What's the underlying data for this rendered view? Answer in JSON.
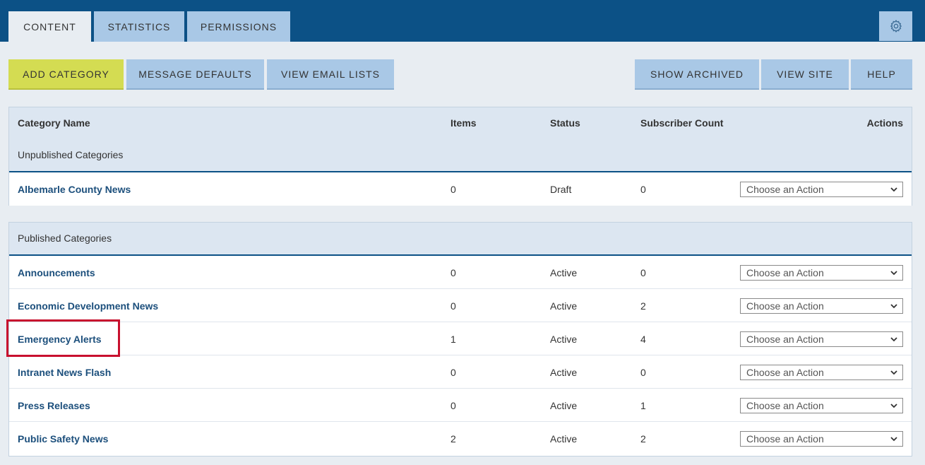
{
  "tabs": [
    {
      "label": "CONTENT"
    },
    {
      "label": "STATISTICS"
    },
    {
      "label": "PERMISSIONS"
    }
  ],
  "toolbar": {
    "add_category": "ADD CATEGORY",
    "message_defaults": "MESSAGE DEFAULTS",
    "view_email_lists": "VIEW EMAIL LISTS",
    "show_archived": "SHOW ARCHIVED",
    "view_site": "VIEW SITE",
    "help": "HELP"
  },
  "icons": {
    "settings": "gear-icon",
    "select_arrow": "chevron-down-icon"
  },
  "colors": {
    "header_bg": "#0c5186",
    "tab_bg": "#a9c8e6",
    "primary_button": "#d4dc52",
    "link": "#1c4f7c",
    "highlight": "#c8102e"
  },
  "table": {
    "columns": {
      "name": "Category Name",
      "items": "Items",
      "status": "Status",
      "subscribers": "Subscriber Count",
      "actions": "Actions"
    },
    "unpublished": {
      "label": "Unpublished Categories",
      "rows": [
        {
          "name": "Albemarle County News",
          "items": "0",
          "status": "Draft",
          "subscribers": "0",
          "action": "Choose an Action"
        }
      ]
    },
    "published": {
      "label": "Published Categories",
      "rows": [
        {
          "name": "Announcements",
          "items": "0",
          "status": "Active",
          "subscribers": "0",
          "action": "Choose an Action"
        },
        {
          "name": "Economic Development News",
          "items": "0",
          "status": "Active",
          "subscribers": "2",
          "action": "Choose an Action"
        },
        {
          "name": "Emergency Alerts",
          "items": "1",
          "status": "Active",
          "subscribers": "4",
          "action": "Choose an Action"
        },
        {
          "name": "Intranet News Flash",
          "items": "0",
          "status": "Active",
          "subscribers": "0",
          "action": "Choose an Action"
        },
        {
          "name": "Press Releases",
          "items": "0",
          "status": "Active",
          "subscribers": "1",
          "action": "Choose an Action"
        },
        {
          "name": "Public Safety News",
          "items": "2",
          "status": "Active",
          "subscribers": "2",
          "action": "Choose an Action"
        }
      ]
    }
  }
}
